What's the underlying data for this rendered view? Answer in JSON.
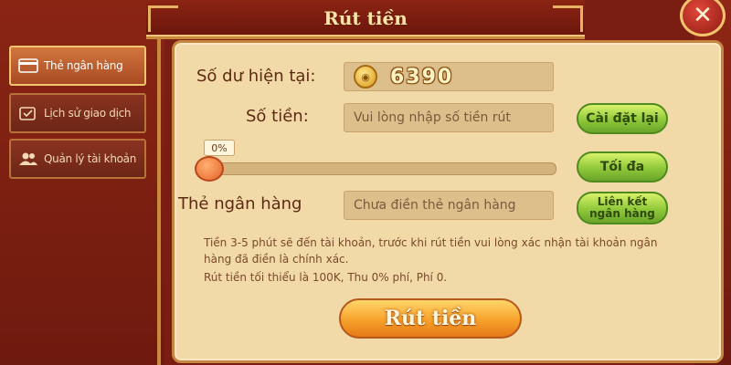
{
  "header": {
    "title": "Rút tiền",
    "close_label": "✕"
  },
  "sidebar": {
    "items": [
      {
        "label": "Thẻ ngân hàng",
        "icon": "card-icon",
        "active": true
      },
      {
        "label": "Lịch sử giao dịch",
        "icon": "history-icon",
        "active": false
      },
      {
        "label": "Quản lý tài khoản",
        "icon": "users-icon",
        "active": false
      }
    ]
  },
  "form": {
    "balance_label": "Số dư hiện tại:",
    "balance_value": "6390",
    "amount_label": "Số tiền:",
    "amount_placeholder": "Vui lòng nhập số tiền rút",
    "reset_button": "Cài đặt lại",
    "slider_percent": "0%",
    "max_button": "Tối đa",
    "bank_label": "Thẻ ngân hàng",
    "bank_placeholder": "Chưa điền thẻ ngân hàng",
    "link_bank_button_line1": "Liên kết",
    "link_bank_button_line2": "ngân hàng"
  },
  "notes": {
    "line1": "Tiền 3-5 phút sẽ đến tài khoản, trước khi rút tiền vui lòng xác nhận tài khoản ngân hàng đã điền là chính xác.",
    "line2": "Rút tiền tối thiểu là 100K, Thu 0% phí, Phí 0."
  },
  "submit_button": "Rút tiền",
  "colors": {
    "panel_bg": "#f1d9a8",
    "frame": "#7a1d12",
    "accent_gold": "#c98a3d",
    "green_button": "#8fc83a",
    "orange_button": "#f7a12b"
  }
}
